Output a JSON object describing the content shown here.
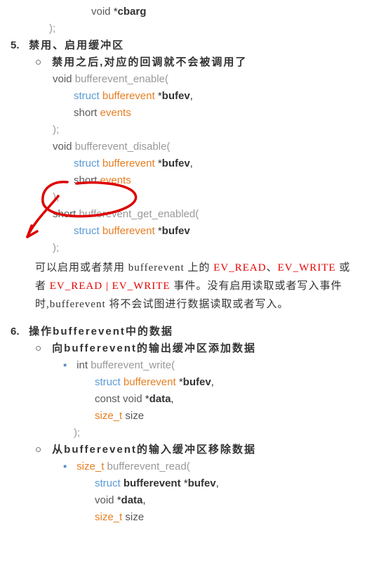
{
  "top_tail": {
    "line1_void": "void",
    "line1_star": "*",
    "line1_param": "cbarg",
    "line2": ");"
  },
  "section5": {
    "num": "5.",
    "title": "禁用、启用缓冲区",
    "sub1": "禁用之后,对应的回调就不会被调用了",
    "func1": {
      "ret": "void",
      "name": "bufferevent_enable",
      "open": "(",
      "p1_kw": "struct",
      "p1_type": "bufferevent",
      "p1_star": "*",
      "p1_name": "bufev",
      "p1_comma": ",",
      "p2_kw": "short",
      "p2_name": "events",
      "close": ");"
    },
    "func2": {
      "ret": "void",
      "name": "bufferevent_disable",
      "open": "(",
      "p1_kw": "struct",
      "p1_type": "bufferevent",
      "p1_star": "*",
      "p1_name": "bufev",
      "p1_comma": ",",
      "p2_kw": "short",
      "p2_name": "events",
      "close": ");"
    },
    "func3": {
      "ret": "short",
      "name": "bufferevent_get_enabled",
      "open": "(",
      "p1_kw": "struct",
      "p1_type": "bufferevent",
      "p1_star": "*",
      "p1_name": "bufev",
      "close": ");"
    },
    "desc": {
      "t1": "可以启用或者禁用 bufferevent 上的 ",
      "r1": "EV_READ",
      "t2": "、",
      "r2": "EV_WRITE",
      "t3": " 或者 ",
      "r3": "EV_READ | EV_WRITE",
      "t4": " 事件。没有启用读取或者写入事件时,bufferevent 将不会试图进行数据读取或者写入。"
    }
  },
  "section6": {
    "num": "6.",
    "title": "操作bufferevent中的数据",
    "sub1": "向bufferevent的输出缓冲区添加数据",
    "func1": {
      "ret": "int",
      "name": "bufferevent_write",
      "open": "(",
      "p1_kw": "struct",
      "p1_type": "bufferevent",
      "p1_star": "*",
      "p1_name": "bufev",
      "p1_comma": ",",
      "p2_kw": "const",
      "p2_type": "void",
      "p2_star": "*",
      "p2_name": "data",
      "p2_comma": ",",
      "p3_kw": "size_t",
      "p3_name": "size",
      "close": ");"
    },
    "sub2": "从bufferevent的输入缓冲区移除数据",
    "func2": {
      "ret": "size_t",
      "name": "bufferevent_read",
      "open": "(",
      "p1_kw": "struct",
      "p1_type": "bufferevent",
      "p1_star": " *",
      "p1_name": "bufev",
      "p1_comma": ",",
      "p2_kw": "void",
      "p2_star": " *",
      "p2_name": "data",
      "p2_comma": ",",
      "p3_kw": "size_t",
      "p3_name": " size"
    }
  }
}
